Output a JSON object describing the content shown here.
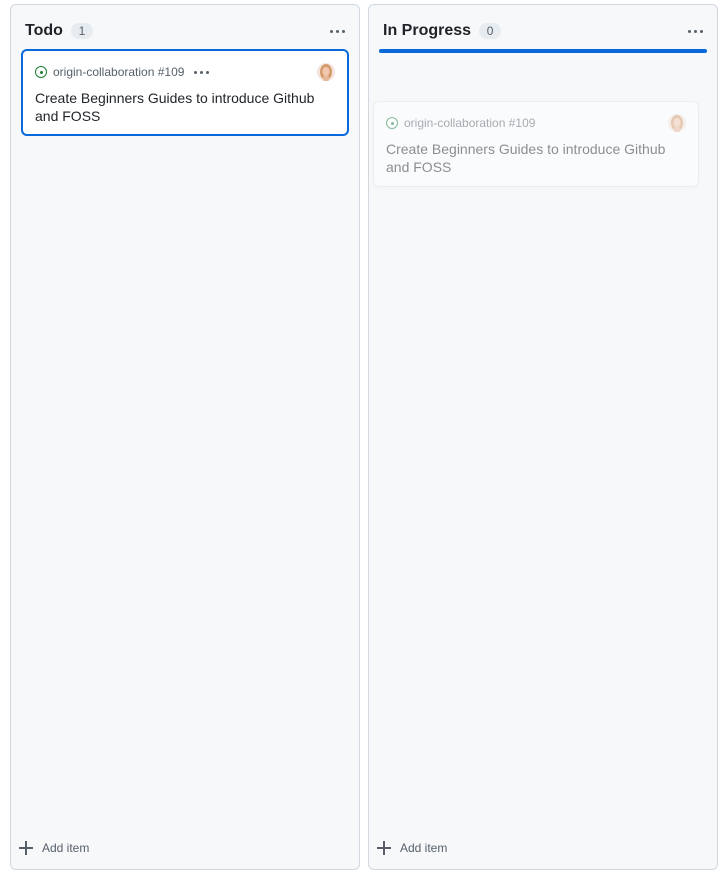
{
  "columns": [
    {
      "title": "Todo",
      "count": "1",
      "add_label": "Add item",
      "card": {
        "repo_ref": "origin-collaboration #109",
        "title": "Create Beginners Guides to introduce Github and FOSS"
      }
    },
    {
      "title": "In Progress",
      "count": "0",
      "add_label": "Add item",
      "drag_preview": {
        "repo_ref": "origin-collaboration #109",
        "title": "Create Beginners Guides to introduce Github and FOSS"
      }
    }
  ],
  "colors": {
    "accent": "#0969da",
    "issue_open": "#1a7f37",
    "column_bg": "#f6f8fa"
  },
  "icons": {
    "issue": "issue-opened-icon",
    "menu": "kebab-horizontal-icon",
    "add": "plus-icon"
  }
}
